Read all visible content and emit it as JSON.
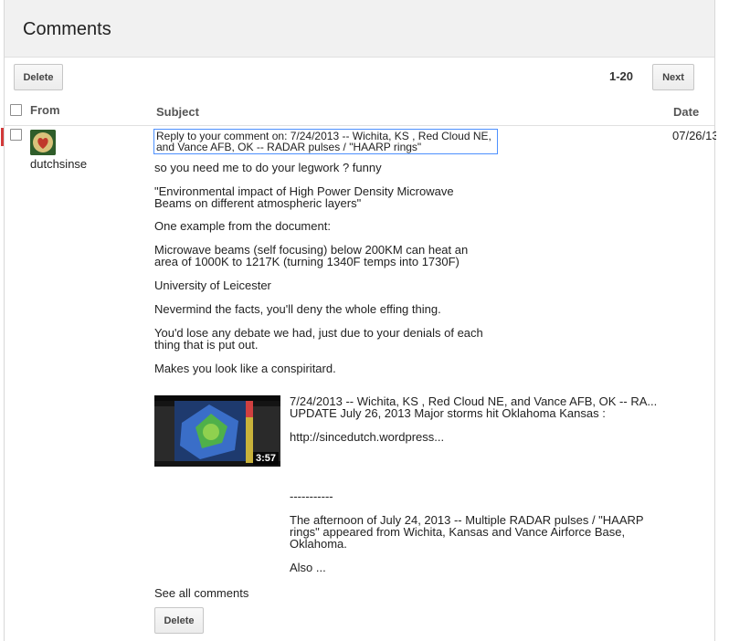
{
  "header": {
    "title": "Comments"
  },
  "toolbar": {
    "delete_label": "Delete",
    "range": "1-20",
    "next_label": "Next"
  },
  "columns": {
    "from": "From",
    "subject": "Subject",
    "date": "Date"
  },
  "comment": {
    "author": "dutchsinse",
    "subject_line1": "Reply to your comment on: 7/24/2013 -- Wichita, KS , Red Cloud NE,",
    "subject_line2": "and Vance AFB, OK -- RADAR pulses / \"HAARP rings\"",
    "date": "07/26/13",
    "paragraphs": [
      [
        "so you need me to do your legwork ? funny"
      ],
      [
        "\"Environmental impact of High Power Density Microwave",
        "Beams on different atmospheric layers\""
      ],
      [
        "One example from the document:"
      ],
      [
        "Microwave beams (self focusing) below 200KM can heat an",
        "area of 1000K to 1217K (turning 1340F temps into 1730F)"
      ],
      [
        "University of Leicester"
      ],
      [
        "Nevermind the facts, you'll deny the whole effing thing."
      ],
      [
        "You'd lose any debate we had, just due to your denials of each",
        "thing that is put out."
      ],
      [
        "Makes you look like a conspiritard."
      ]
    ],
    "video": {
      "duration": "3:57",
      "title": "7/24/2013 -- Wichita, KS , Red Cloud NE, and Vance AFB, OK -- RA...",
      "line2": "UPDATE July 26, 2013 Major storms hit Oklahoma Kansas :",
      "link": "http://sincedutch.wordpress...",
      "separator": "-----------",
      "desc_line1": "The afternoon of July 24, 2013 -- Multiple RADAR pulses / \"HAARP",
      "desc_line2": "rings\" appeared from Wichita, Kansas and Vance Airforce Base,",
      "desc_line3": "Oklahoma.",
      "also": "Also ..."
    },
    "see_all": "See all comments",
    "delete_label": "Delete"
  },
  "colors": {
    "accent": "#4d90fe",
    "marker": "#d23a3a"
  }
}
